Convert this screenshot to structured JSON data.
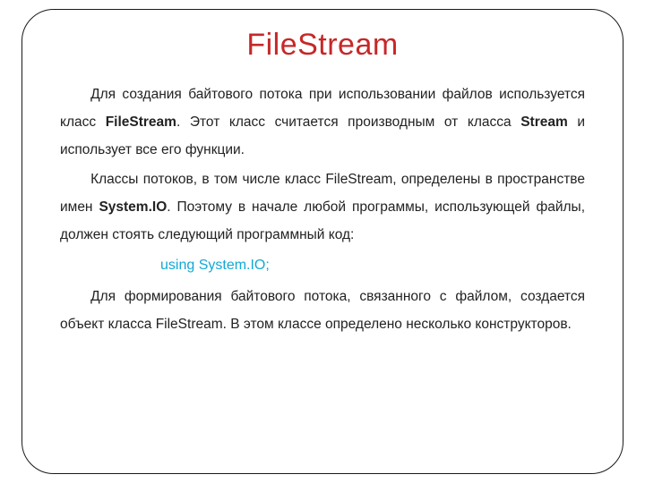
{
  "title": "FileStream",
  "p1": {
    "a": "Для создания байтового потока при использовании файлов используется класс ",
    "b": "FileStream",
    "c": ". Этот класс считается производным от класса ",
    "d": "Stream",
    "e": " и использует все его функции."
  },
  "p2": {
    "a": "Классы потоков, в том числе класс FileStream, определены в пространстве имен ",
    "b": "System.IO",
    "c": ". Поэтому в начале любой программы, использующей файлы, должен стоять следующий программный код:"
  },
  "code": "using System.IO;",
  "p3": "Для формирования байтового потока, связанного с файлом, создается объект класса FileStream. В этом классе определено несколько конструкторов."
}
